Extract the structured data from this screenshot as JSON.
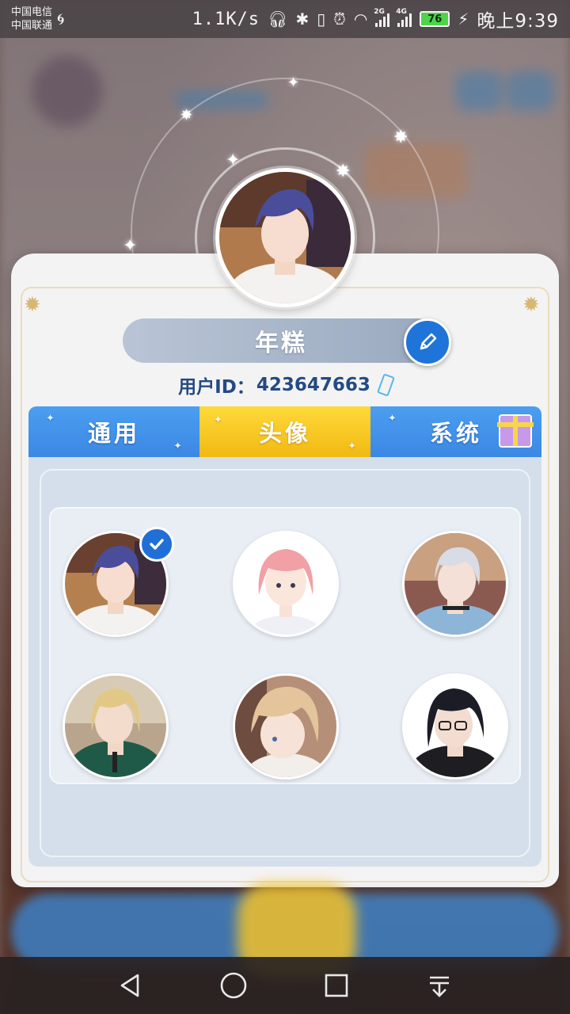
{
  "status_bar": {
    "carrier_1": "中国电信",
    "carrier_2": "中国联通",
    "net_speed": "1.1K/s",
    "sig1_tag": "2G",
    "sig2_tag": "4G",
    "battery": "76",
    "time": "晚上9:39"
  },
  "profile": {
    "nickname": "年糕",
    "user_id_label": "用户ID：",
    "user_id": "423647663"
  },
  "tabs": [
    {
      "label": "通用"
    },
    {
      "label": "头像"
    },
    {
      "label": "系统"
    }
  ],
  "active_tab": "头像",
  "avatars": [
    {
      "name": "avatar-1",
      "selected": true
    },
    {
      "name": "avatar-2",
      "selected": false
    },
    {
      "name": "avatar-3",
      "selected": false
    },
    {
      "name": "avatar-4",
      "selected": false
    },
    {
      "name": "avatar-5",
      "selected": false
    },
    {
      "name": "avatar-6",
      "selected": false
    }
  ],
  "icons": {
    "edit": "pencil-icon",
    "copy": "phone-icon",
    "gift": "gift-icon",
    "selected": "check-icon",
    "nav": [
      "back-icon",
      "home-icon",
      "recents-icon",
      "menu-down-icon"
    ]
  }
}
